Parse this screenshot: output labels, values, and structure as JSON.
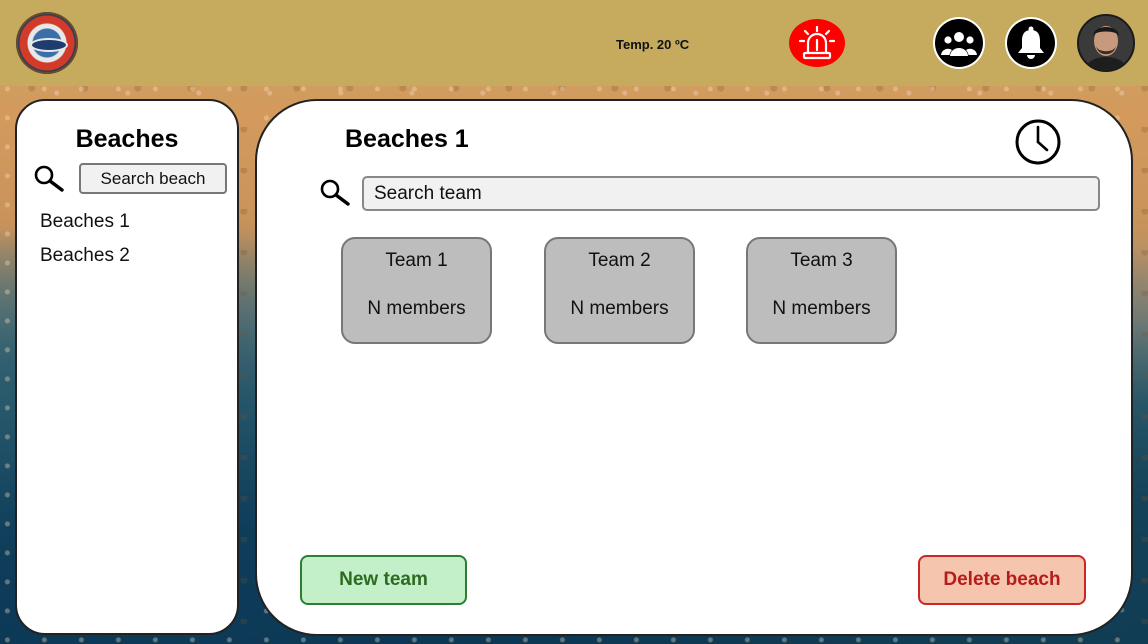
{
  "header": {
    "temperature": "Temp. 20 ºC",
    "icons": {
      "logo": "lifebuoy-logo-icon",
      "alarm": "siren-icon",
      "teams": "users-icon",
      "notifications": "bell-icon",
      "profile": "user-avatar"
    },
    "colors": {
      "bar": "#c6ab5e",
      "alarm": "#ff0000"
    }
  },
  "sidebar": {
    "title": "Beaches",
    "search_placeholder": "Search beach",
    "items": [
      {
        "label": "Beaches 1"
      },
      {
        "label": "Beaches 2"
      }
    ]
  },
  "main": {
    "title": "Beaches 1",
    "search_placeholder": "Search team",
    "teams": [
      {
        "name": "Team 1",
        "members": "N members"
      },
      {
        "name": "Team 2",
        "members": "N members"
      },
      {
        "name": "Team 3",
        "members": "N members"
      }
    ],
    "new_team_label": "New team",
    "delete_beach_label": "Delete beach",
    "colors": {
      "new_team_bg": "#c3f0c8",
      "delete_beach_bg": "#f5c6ad",
      "team_card_bg": "#bdbdbd"
    }
  }
}
